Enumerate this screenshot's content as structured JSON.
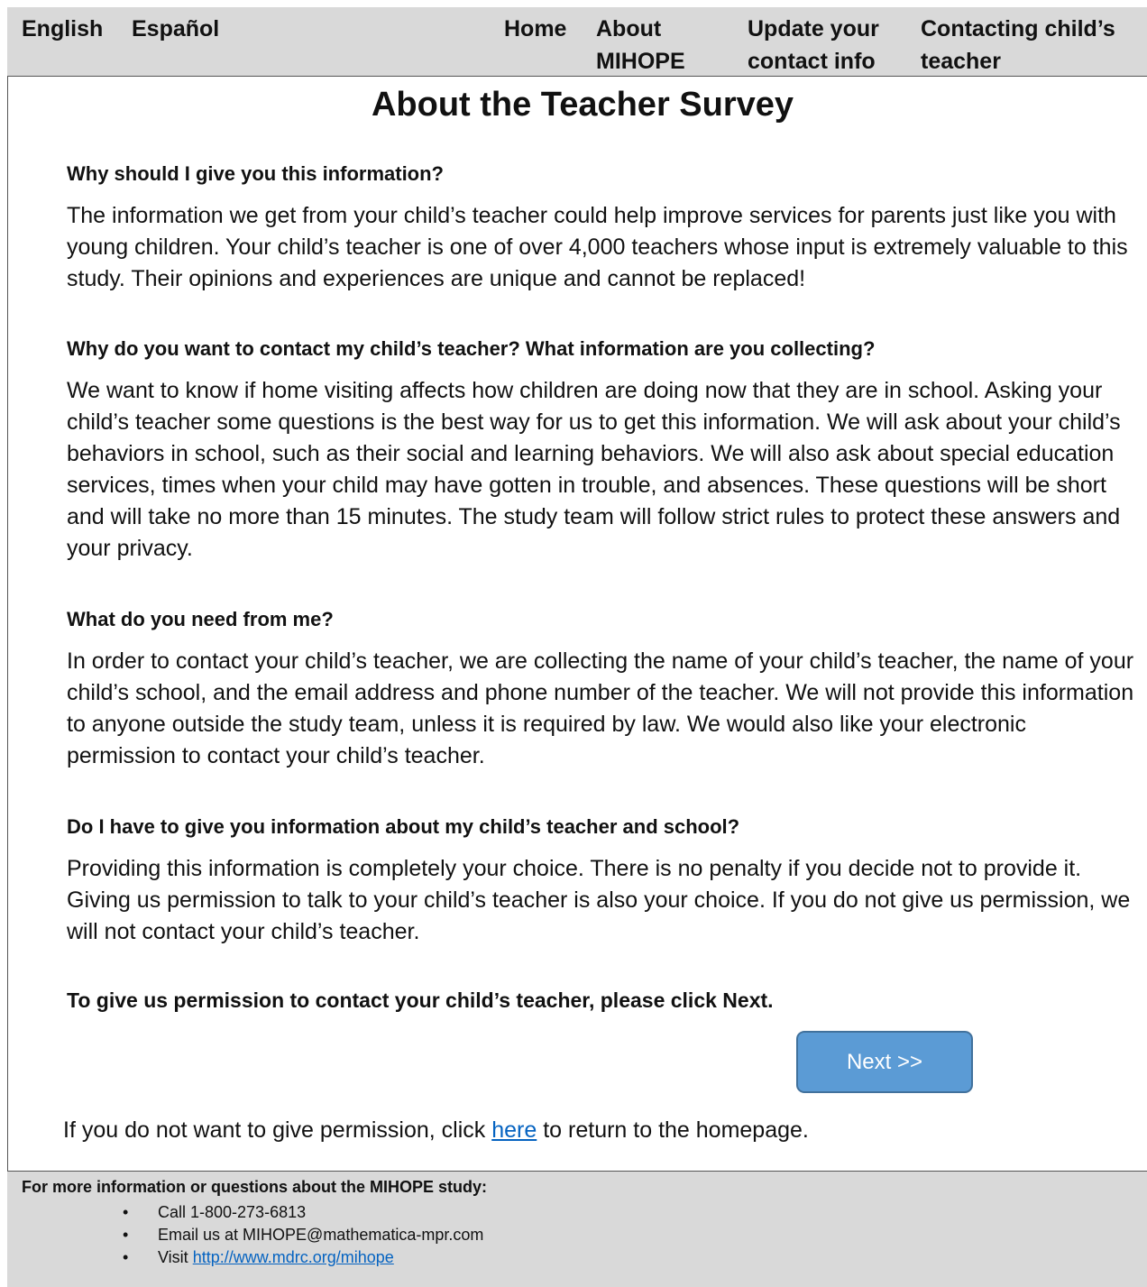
{
  "nav": {
    "english": "English",
    "espanol": "Español",
    "home": "Home",
    "about": "About MIHOPE",
    "update": "Update your contact info",
    "contact": "Contacting child’s teacher"
  },
  "page_title": "About the Teacher Survey",
  "sections": [
    {
      "question": "Why should I give you this information?",
      "answer": "The information we get from your child’s teacher could help improve services for parents just like you with young children. Your child’s teacher is one of over 4,000 teachers whose input is extremely valuable to this study. Their opinions and experiences are unique and cannot be replaced!"
    },
    {
      "question": "Why do you want to contact my child’s teacher? What information are you collecting?",
      "answer": "We want to know if home visiting affects how children are doing now that they are in school. Asking your child’s teacher some questions is the best way for us to get this information. We will ask about your child’s behaviors in school, such as their social and learning behaviors. We will also ask about special education services, times when your child may have gotten in trouble, and absences. These questions will be short and will take no more than 15 minutes. The study team will follow strict rules to protect these answers and your privacy."
    },
    {
      "question": "What do you need from me?",
      "answer": "In order to contact your child’s teacher, we are collecting the name of your child’s teacher, the name of your child’s school, and the email address and phone number of the teacher. We will not provide this information to anyone outside the study team, unless it is required by law. We would also like your electronic permission to contact your child’s teacher."
    },
    {
      "question": "Do I have to give you information about my child’s teacher and school?",
      "answer": "Providing this information is completely your choice. There is no penalty if you decide not to provide it. Giving us permission to talk to your child’s teacher is also your choice. If you do not give us permission, we will not contact your child’s teacher."
    }
  ],
  "cta": "To give us permission to contact your child’s teacher, please click Next.",
  "next_button": "Next >>",
  "decline": {
    "before": "If you do not want to give permission, click ",
    "link": "here",
    "after": " to return to the homepage."
  },
  "footer": {
    "title": "For more information or questions about the MIHOPE study:",
    "call": "Call 1-800-273-6813",
    "email": "Email us at MIHOPE@mathematica-mpr.com",
    "visit_prefix": "Visit ",
    "visit_link": "http://www.mdrc.org/mihope"
  }
}
